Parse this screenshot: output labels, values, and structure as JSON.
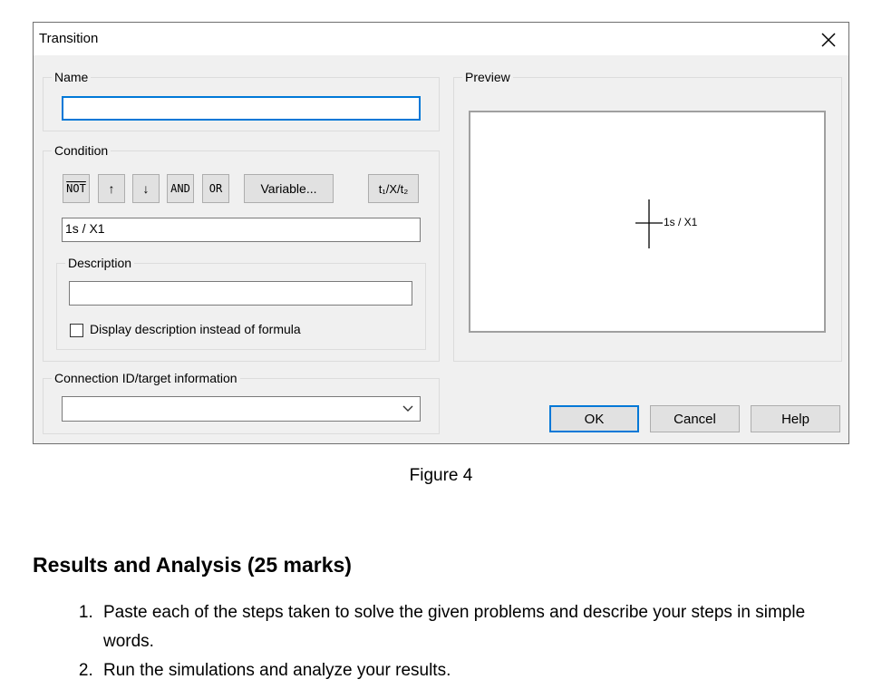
{
  "dialog": {
    "title": "Transition",
    "name_group": {
      "legend": "Name",
      "value": ""
    },
    "condition_group": {
      "legend": "Condition",
      "buttons": {
        "not": "NOT",
        "rising": "↑",
        "falling": "↓",
        "and": "AND",
        "or": "OR",
        "variable": "Variable...",
        "time": "t₁/X/t₂"
      },
      "formula": "1s / X1",
      "description_group": {
        "legend": "Description",
        "value": "",
        "checkbox_label": "Display description instead of formula",
        "checkbox_checked": false
      }
    },
    "connection_group": {
      "legend": "Connection ID/target information",
      "value": ""
    },
    "preview_group": {
      "legend": "Preview",
      "transition_label": "1s / X1"
    },
    "buttons": {
      "ok": "OK",
      "cancel": "Cancel",
      "help": "Help"
    }
  },
  "document": {
    "caption": "Figure 4",
    "heading": "Results and Analysis (25 marks)",
    "steps": [
      "Paste each of the steps taken to solve the given problems and describe your steps in simple words.",
      "Run the simulations and analyze your results."
    ]
  }
}
